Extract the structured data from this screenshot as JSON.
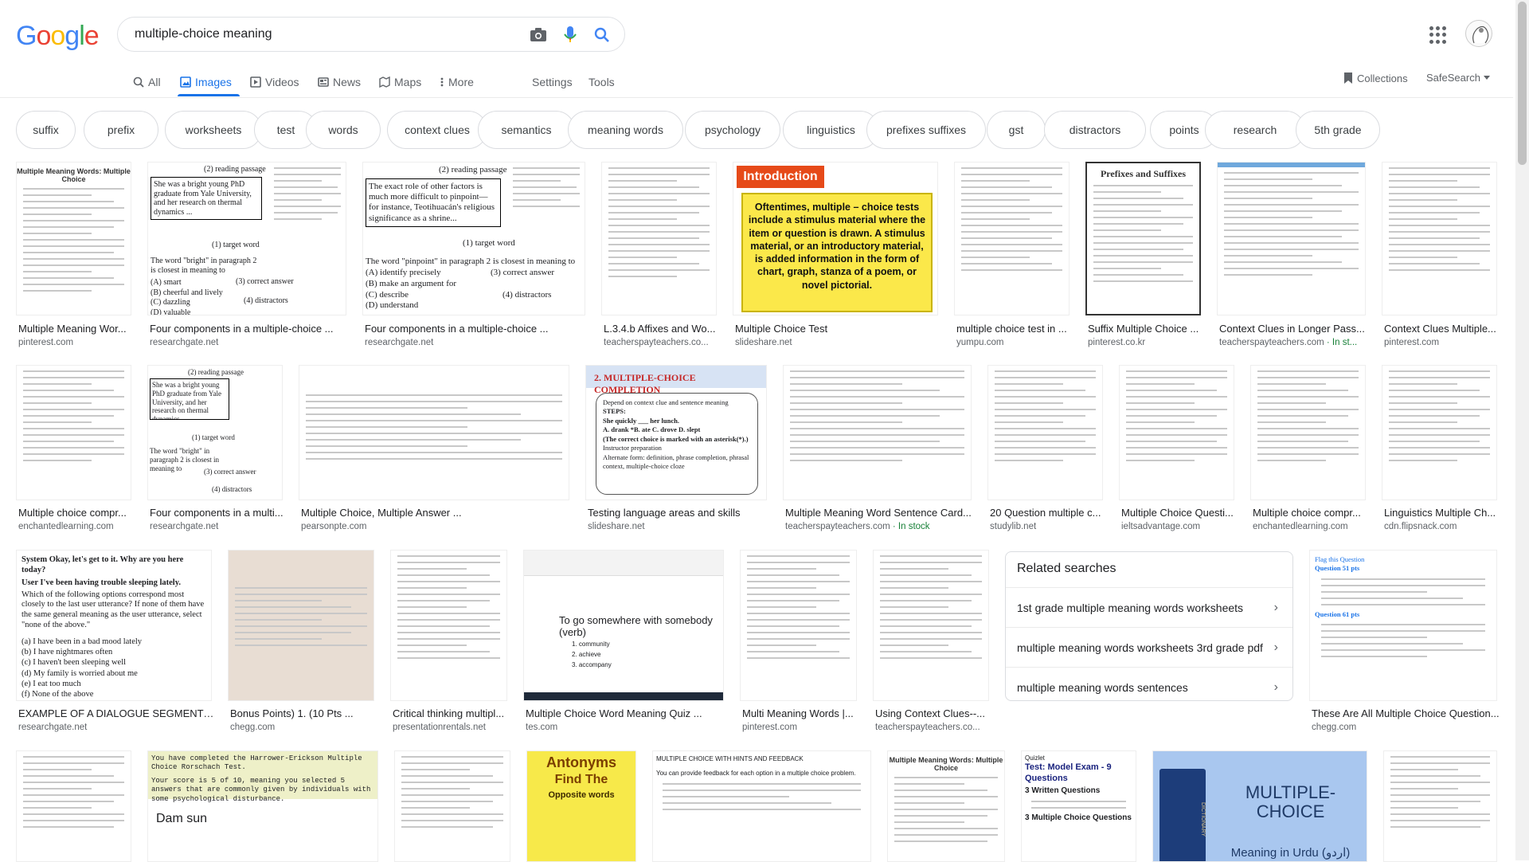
{
  "header": {
    "logo": "Google",
    "search_value": "multiple-choice meaning"
  },
  "tabs": [
    {
      "label": "All",
      "icon": "search-icon"
    },
    {
      "label": "Images",
      "icon": "image-icon",
      "active": true
    },
    {
      "label": "Videos",
      "icon": "video-icon"
    },
    {
      "label": "News",
      "icon": "news-icon"
    },
    {
      "label": "Maps",
      "icon": "map-icon"
    },
    {
      "label": "More",
      "icon": "more-icon"
    },
    {
      "label": "Settings"
    },
    {
      "label": "Tools"
    }
  ],
  "right_links": {
    "collections": "Collections",
    "safesearch": "SafeSearch"
  },
  "chips": [
    "suffix",
    "prefix",
    "worksheets",
    "test",
    "words",
    "context clues",
    "semantics",
    "meaning words",
    "psychology",
    "linguistics",
    "prefixes suffixes",
    "gst",
    "distractors",
    "points",
    "research",
    "5th grade"
  ],
  "results": [
    {
      "caption": "Multiple Meaning Wor...",
      "source": "pinterest.com"
    },
    {
      "caption": "Four components in a multiple-choice ...",
      "source": "researchgate.net"
    },
    {
      "caption": "Four components in a multiple-choice ...",
      "source": "researchgate.net"
    },
    {
      "caption": "L.3.4.b Affixes and Wo...",
      "source": "teacherspayteachers.co..."
    },
    {
      "caption": "Multiple Choice Test",
      "source": "slideshare.net"
    },
    {
      "caption": "multiple choice test in ...",
      "source": "yumpu.com"
    },
    {
      "caption": "Suffix Multiple Choice ...",
      "source": "pinterest.co.kr"
    },
    {
      "caption": "Context Clues in Longer Pass...",
      "source": "teacherspayteachers.com",
      "stock": " · In st..."
    },
    {
      "caption": "Context Clues Multiple...",
      "source": "pinterest.com"
    },
    {
      "caption": "Multiple choice compr...",
      "source": "enchantedlearning.com"
    },
    {
      "caption": "Four components in a multi...",
      "source": "researchgate.net"
    },
    {
      "caption": "Multiple Choice, Multiple Answer ...",
      "source": "pearsonpte.com"
    },
    {
      "caption": "Testing language areas and skills",
      "source": "slideshare.net"
    },
    {
      "caption": "Multiple Meaning Word Sentence Card...",
      "source": "teacherspayteachers.com",
      "stock": " · In stock"
    },
    {
      "caption": "20 Question multiple c...",
      "source": "studylib.net"
    },
    {
      "caption": "Multiple Choice Questi...",
      "source": "ieltsadvantage.com"
    },
    {
      "caption": "Multiple choice compr...",
      "source": "enchantedlearning.com"
    },
    {
      "caption": "Linguistics Multiple Ch...",
      "source": "cdn.flipsnack.com"
    },
    {
      "caption": "EXAMPLE OF A DIALOGUE SEGMENT ...",
      "source": "researchgate.net"
    },
    {
      "caption": "Bonus Points) 1. (10 Pts ...",
      "source": "chegg.com"
    },
    {
      "caption": "Critical thinking multipl...",
      "source": "presentationrentals.net"
    },
    {
      "caption": "Multiple Choice Word Meaning Quiz ...",
      "source": "tes.com"
    },
    {
      "caption": "Multi Meaning Words |...",
      "source": "pinterest.com"
    },
    {
      "caption": "Using Context Clues--...",
      "source": "teacherspayteachers.co..."
    },
    {
      "caption": "These Are All Multiple Choice Question...",
      "source": "chegg.com"
    }
  ],
  "thumb_text": {
    "t2_label": "(2) reading passage",
    "t2_passage": "She was a bright young PhD graduate from Yale University, and her research on thermal dynamics ...",
    "t2_target": "(1) target word",
    "t2_question": "The word \"bright\" in paragraph 2 is closest in meaning to",
    "t2_opts": [
      "(A) smart",
      "(B) cheerful and lively",
      "(C) dazzling",
      "(D) valuable"
    ],
    "t2_correct": "(3) correct answer",
    "t2_distract": "(4) distractors",
    "t3_label": "(2) reading passage",
    "t3_passage": "The exact role of other factors is much more difficult to pinpoint— for instance, Teotihuacán's religious significance as a shrine...",
    "t3_target": "(1) target word",
    "t3_question": "The word \"pinpoint\" in paragraph 2 is closest in meaning to",
    "t3_opts": [
      "(A) identify precisely",
      "(B) make an argument for",
      "(C) describe",
      "(D) understand"
    ],
    "t3_correct": "(3) correct answer",
    "t3_distract": "(4) distractors",
    "t5_title": "Introduction",
    "t5_body": "Oftentimes, multiple – choice tests include a stimulus material where the item or question is drawn. A stimulus material, or an introductory material, is added information in the form of chart, graph, stanza of a poem, or novel pictorial.",
    "t7_title": "Prefixes and Suffixes",
    "t13_title": "2. MULTIPLE-CHOICE COMPLETION",
    "t13_lines": [
      "Depend on context clue and sentence meaning",
      "STEPS:",
      "She quickly ___ her lunch.",
      "A. drank  *B. ate  C. drove  D. slept",
      "(The correct choice is marked with an asterisk(*).)",
      "Instructor preparation",
      "Alternate form: definition, phrase completion, phrasal context, multiple-choice cloze"
    ],
    "t19_dialogue": [
      "System  Okay, let's get to it. Why are you here today?",
      "User  I've been having trouble sleeping lately.",
      "Which of the following options correspond most closely to the last user utterance? If none of them have the same general meaning as the user utterance, select \"none of the above.\""
    ],
    "t19_opts": [
      "(a)  I have been in a bad mood lately",
      "(b)  I have nightmares often",
      "(c)  I haven't been sleeping well",
      "(d)  My family is worried about me",
      "(e)  I eat too much",
      "(f)  None of the above"
    ],
    "t22_text": "To go somewhere with somebody (verb)",
    "t22_opts": [
      "1. community",
      "2. achieve",
      "3. accompany"
    ],
    "t25_q1": "Flag this Question",
    "t25_q1b": "Question 51 pts",
    "t25_q2": "Question 61 pts",
    "b1_title": "You have completed the Harrower-Erickson Multiple Choice Rorschach Test.",
    "b1_body": "Your score is 5 of 10, meaning you selected 5 answers that are commonly given by individuals with some psychological disturbance.",
    "b1_name": "Dam sun",
    "b3_title": "Antonyms",
    "b3_sub": "Find The",
    "b3_foot": "Opposite words",
    "b4_title": "MULTIPLE CHOICE WITH HINTS AND FEEDBACK",
    "b4_body": "You can provide feedback for each option in a multiple choice problem.",
    "b6_brand": "Quizlet",
    "b6_title": "Test: Model Exam - 9 Questions",
    "b6_sub": "3 Written Questions",
    "b6_sub2": "3 Multiple Choice Questions",
    "b7_title": "MULTIPLE-CHOICE",
    "b7_sub": "Meaning in Urdu (اردو)",
    "b7_dict": "DICTIONARY"
  },
  "related": {
    "title": "Related searches",
    "items": [
      "1st grade multiple meaning words worksheets",
      "multiple meaning words worksheets 3rd grade pdf",
      "multiple meaning words sentences"
    ]
  },
  "colors": {
    "blue": "#4285F4",
    "red": "#EA4335",
    "yellow": "#FBBC05",
    "green": "#34A853",
    "accent": "#1a73e8"
  }
}
